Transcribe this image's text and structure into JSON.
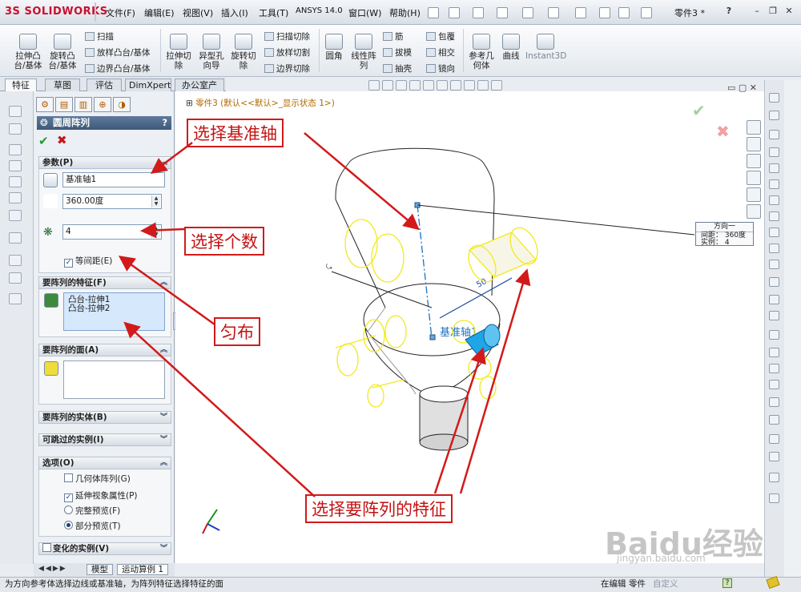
{
  "app": {
    "logo": "SOLIDWORKS",
    "logo_prefix": "3S",
    "doc_title": "零件3 *",
    "help": "?"
  },
  "menu": [
    "文件(F)",
    "编辑(E)",
    "视图(V)",
    "插入(I)",
    "工具(T)",
    "ANSYS 14.0",
    "窗口(W)",
    "帮助(H)"
  ],
  "ribbon": {
    "big": [
      {
        "l1": "拉伸凸",
        "l2": "台/基体"
      },
      {
        "l1": "旋转凸",
        "l2": "台/基体"
      },
      {
        "l1": "拉伸切",
        "l2": "除"
      },
      {
        "l1": "异型孔",
        "l2": "向导"
      },
      {
        "l1": "旋转切",
        "l2": "除"
      },
      {
        "l1": "圆角",
        "l2": ""
      },
      {
        "l1": "线性阵",
        "l2": "列"
      },
      {
        "l1": "参考几",
        "l2": "何体"
      },
      {
        "l1": "曲线",
        "l2": ""
      },
      {
        "l1": "Instant3D",
        "l2": ""
      }
    ],
    "small": [
      "扫描",
      "放样凸台/基体",
      "边界凸台/基体",
      "扫描切除",
      "放样切割",
      "边界切除",
      "筋",
      "拔模",
      "抽壳",
      "包覆",
      "相交",
      "镜向"
    ]
  },
  "tabs": [
    "特征",
    "草图",
    "评估",
    "DimXpert",
    "办公室产品"
  ],
  "feature_tree": "零件3 (默认<<默认>_显示状态 1>)",
  "pm": {
    "title": "圆周阵列",
    "help": "?",
    "params_header": "参数(P)",
    "axis_value": "基准轴1",
    "angle_value": "360.00度",
    "count_value": "4",
    "equal_spacing": "等间距(E)",
    "features_header": "要阵列的特征(F)",
    "features": [
      "凸台-拉伸1",
      "凸台-拉伸2"
    ],
    "faces_header": "要阵列的面(A)",
    "bodies_header": "要阵列的实体(B)",
    "skip_header": "可跳过的实例(I)",
    "options_header": "选项(O)",
    "opt_geom": "几何体阵列(G)",
    "opt_visual": "延伸视象属性(P)",
    "opt_full": "完整预览(F)",
    "opt_partial": "部分预览(T)",
    "vary_header": "变化的实例(V)"
  },
  "bottom_tabs": [
    "模型",
    "运动算例 1"
  ],
  "status": {
    "hint": "为方向参考体选择边线或基准轴，为阵列特征选择特征的面",
    "mode": "在编辑 零件",
    "custom": "自定义"
  },
  "viewport": {
    "axis_label": "基准轴1",
    "dim_label": "50",
    "tooltip_title": "方向一",
    "tooltip_l1": "间距： 360度",
    "tooltip_l2": "实例： 4"
  },
  "callouts": {
    "c1": "选择基准轴",
    "c2": "选择个数",
    "c3": "匀布",
    "c4": "选择要阵列的特征"
  },
  "watermark": {
    "main": "Baidu经验",
    "sub": "jingyan.baidu.com"
  },
  "colors": {
    "callout_red": "#d21a1a",
    "preview_yellow": "#f2ea1c",
    "feature_blue": "#1ea6e6",
    "header_blue": "#4a6688"
  }
}
